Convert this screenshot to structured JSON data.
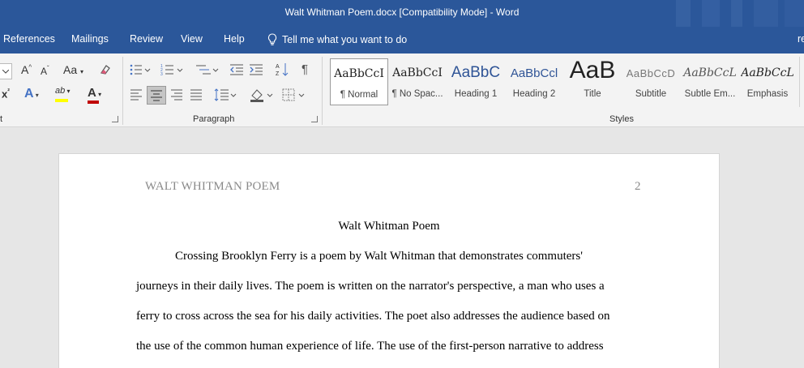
{
  "titlebar": {
    "title": "Walt Whitman Poem.docx [Compatibility Mode]  -  Word"
  },
  "menubar": {
    "tabs": [
      "References",
      "Mailings",
      "Review",
      "View",
      "Help"
    ],
    "tell_me": "Tell me what you want to do",
    "cut_tab": "re"
  },
  "ribbon": {
    "font_group_label": "t",
    "paragraph_group_label": "Paragraph",
    "styles_group_label": "Styles",
    "change_case": "Aa",
    "styles": [
      {
        "preview": "AaBbCcI",
        "label": "¶ Normal"
      },
      {
        "preview": "AaBbCcI",
        "label": "¶ No Spac..."
      },
      {
        "preview": "AaBbC",
        "label": "Heading 1"
      },
      {
        "preview": "AaBbCcl",
        "label": "Heading 2"
      },
      {
        "preview": "AaB",
        "label": "Title"
      },
      {
        "preview": "AaBbCcD",
        "label": "Subtitle"
      },
      {
        "preview": "AaBbCcL",
        "label": "Subtle Em..."
      },
      {
        "preview": "AaBbCcL",
        "label": "Emphasis"
      }
    ]
  },
  "document": {
    "header_text": "WALT WHITMAN POEM",
    "page_number": "2",
    "title": "Walt Whitman Poem",
    "lines": [
      "Crossing Brooklyn Ferry is a poem by Walt Whitman that demonstrates commuters'",
      "journeys in their daily lives. The poem is written on the narrator's perspective, a man who uses a",
      "ferry to cross across the sea for his daily activities. The poet also addresses the audience based on",
      "the use of the common human experience of life. The use of the first-person narrative to address"
    ]
  },
  "colors": {
    "accent": "#2b579a",
    "heading_blue": "#2f5496",
    "font_color_red": "#c00000",
    "highlight_yellow": "#ffff00"
  }
}
